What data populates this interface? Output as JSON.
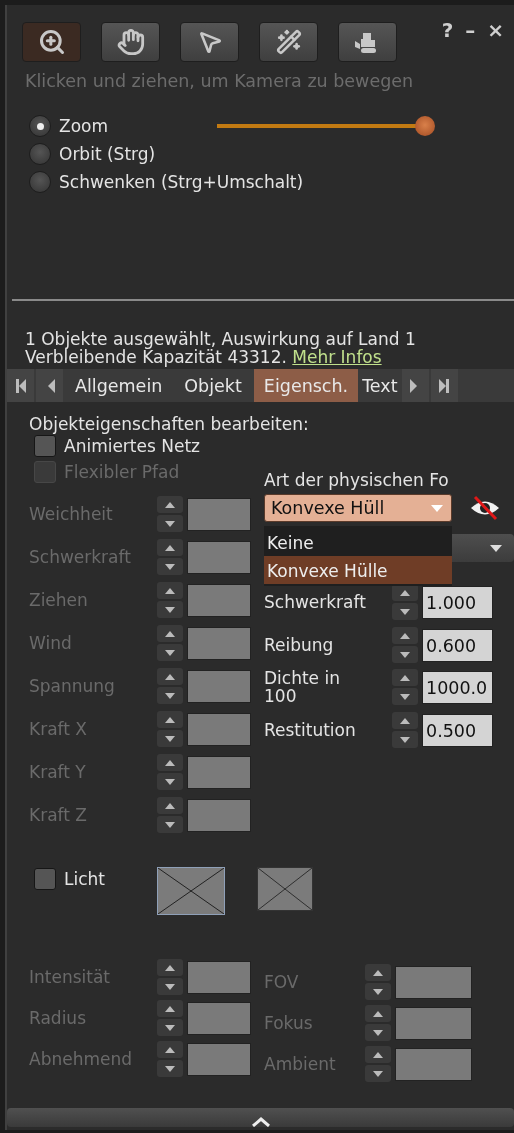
{
  "title_buttons": [
    "?",
    "–",
    "×"
  ],
  "tools": [
    {
      "selected": true
    },
    {
      "selected": false
    },
    {
      "selected": false
    },
    {
      "selected": false
    },
    {
      "selected": false
    }
  ],
  "hint": "Klicken und ziehen, um Kamera zu bewegen",
  "camera_modes": [
    {
      "label": "Zoom",
      "selected": true
    },
    {
      "label": "Orbit (Strg)",
      "selected": false
    },
    {
      "label": "Schwenken (Strg+Umschalt)",
      "selected": false
    }
  ],
  "zoom_slider": {
    "level": 1.0
  },
  "selection_info": {
    "line_1": "1 Objekte ausgewählt, Auswirkung auf Land 1",
    "line_2": "Verbleibende Kapazität 43312.",
    "link": "Mehr Infos"
  },
  "tabs": [
    {
      "label": "Allgemein",
      "selected": false
    },
    {
      "label": "Objekt",
      "selected": false
    },
    {
      "label": "Eigensch.",
      "selected": true
    },
    {
      "label": "Text",
      "selected": false
    }
  ],
  "section_title": "Objekteigenschaften bearbeiten:",
  "options": [
    {
      "label": "Animiertes Netz",
      "checked": false,
      "disabled": false
    },
    {
      "label": "Flexibler Pfad",
      "checked": false,
      "disabled": true
    }
  ],
  "flexible_fields": [
    {
      "label": "Weichheit",
      "disabled": true
    },
    {
      "label": "Schwerkraft",
      "disabled": true
    },
    {
      "label": "Ziehen",
      "disabled": true
    },
    {
      "label": "Wind",
      "disabled": true
    },
    {
      "label": "Spannung",
      "disabled": true
    },
    {
      "label": "Kraft X",
      "disabled": true
    },
    {
      "label": "Kraft Y",
      "disabled": true
    },
    {
      "label": "Kraft Z",
      "disabled": true
    }
  ],
  "physics": {
    "label": "Art der physischen Fo",
    "dropdown": {
      "value": "Konvexe Hüll",
      "expanded": true,
      "options": [
        {
          "label": "Keine",
          "selected": false
        },
        {
          "label": "Konvexe Hülle",
          "selected": true
        }
      ]
    },
    "fields": [
      {
        "label": "Schwerkraft",
        "value": "1.000",
        "disabled": false
      },
      {
        "label": "Reibung",
        "value": "0.600",
        "disabled": false
      },
      {
        "label": "Dichte in 100",
        "value": "1000.0",
        "disabled": false
      },
      {
        "label": "Restitution",
        "value": "0.500",
        "disabled": false
      }
    ]
  },
  "light": {
    "label": "Licht",
    "checked": false,
    "swatches": [
      {
        "selected": true
      },
      {
        "selected": false
      }
    ],
    "fields_left": [
      {
        "label": "Intensität",
        "disabled": true
      },
      {
        "label": "Radius",
        "disabled": true
      },
      {
        "label": "Abnehmend",
        "disabled": true
      }
    ],
    "fields_right": [
      {
        "label": "FOV",
        "disabled": true
      },
      {
        "label": "Fokus",
        "disabled": true
      },
      {
        "label": "Ambient",
        "disabled": true
      }
    ]
  }
}
